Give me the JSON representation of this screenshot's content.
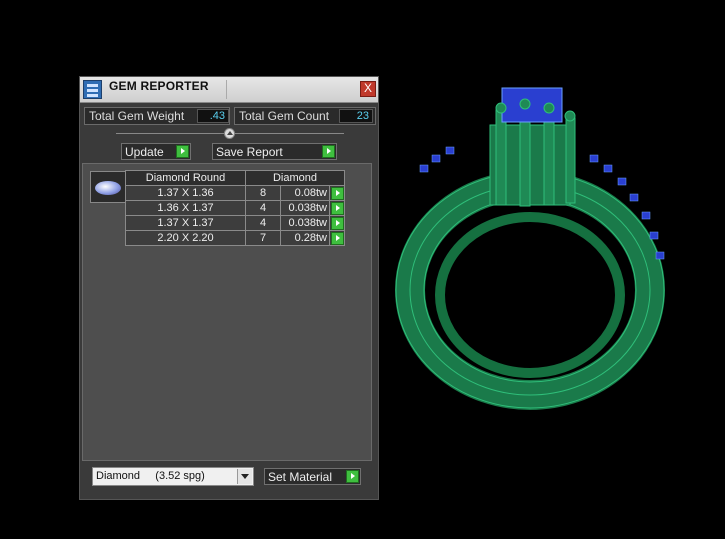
{
  "window": {
    "title": "GEM REPORTER",
    "close_label": "X"
  },
  "stats": {
    "total_weight_label": "Total Gem Weight",
    "total_weight_value": ".43",
    "total_count_label": "Total Gem Count",
    "total_count_value": "23"
  },
  "actions": {
    "update_label": "Update",
    "save_label": "Save Report"
  },
  "report": {
    "headers": {
      "shape": "Diamond Round",
      "material": "Diamond"
    },
    "rows": [
      {
        "size": "1.37 X 1.36",
        "qty": "8",
        "weight": "0.08tw"
      },
      {
        "size": "1.36 X 1.37",
        "qty": "4",
        "weight": "0.038tw"
      },
      {
        "size": "1.37 X 1.37",
        "qty": "4",
        "weight": "0.038tw"
      },
      {
        "size": "2.20 X 2.20",
        "qty": "7",
        "weight": "0.28tw"
      }
    ]
  },
  "material": {
    "selected": "Diamond     (3.52 spg)",
    "set_label": "Set Material"
  },
  "colors": {
    "ring": "#1f8a55",
    "ring_outline": "#2fbf7a",
    "gems": "#2a3fd0",
    "accent_value": "#5ad0f0",
    "go": "#3fbf3f"
  },
  "icons": [
    "app-icon",
    "close-icon",
    "slider-knob-icon",
    "go-arrow-icon",
    "gem-diamond-icon",
    "dropdown-arrow-icon"
  ]
}
